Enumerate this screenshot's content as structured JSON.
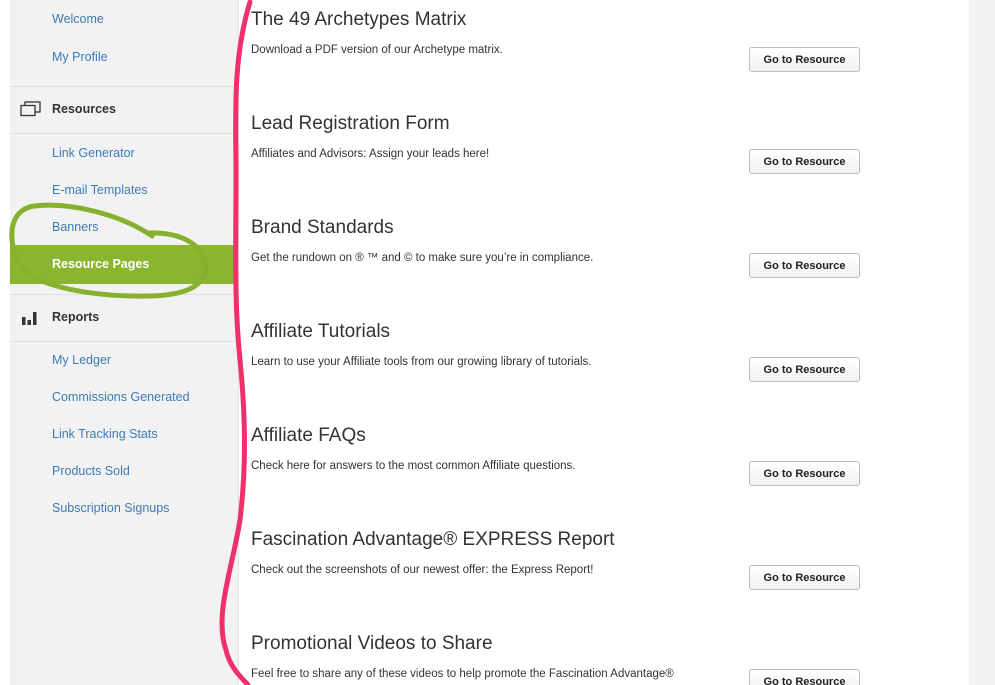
{
  "sidebar": {
    "top_links": [
      "Welcome",
      "My Profile"
    ],
    "resources": {
      "heading": "Resources",
      "icon": "monitor-icon",
      "items": [
        "Link Generator",
        "E-mail Templates",
        "Banners"
      ],
      "active_item": "Resource Pages"
    },
    "reports": {
      "heading": "Reports",
      "icon": "bar-chart-icon",
      "items": [
        "My Ledger",
        "Commissions Generated",
        "Link Tracking Stats",
        "Products Sold",
        "Subscription Signups"
      ]
    }
  },
  "resources": [
    {
      "title": "The 49 Archetypes Matrix",
      "description": "Download a PDF version of our Archetype matrix.",
      "button": "Go to Resource"
    },
    {
      "title": "Lead Registration Form",
      "description": "Affiliates and Advisors: Assign your leads here!",
      "button": "Go to Resource"
    },
    {
      "title": "Brand Standards",
      "description": "Get the rundown on ® ™ and © to make sure you’re in compliance.",
      "button": "Go to Resource"
    },
    {
      "title": "Affiliate Tutorials",
      "description": "Learn to use your Affiliate tools from our growing library of tutorials.",
      "button": "Go to Resource"
    },
    {
      "title": "Affiliate FAQs",
      "description": "Check here for answers to the most common Affiliate questions.",
      "button": "Go to Resource"
    },
    {
      "title": "Fascination Advantage® EXPRESS Report",
      "description": "Check out the screenshots of our newest offer: the Express Report!",
      "button": "Go to Resource"
    },
    {
      "title": "Promotional Videos to Share",
      "description": "Feel free to share any of these videos to help promote the Fascination Advantage®",
      "button": "Go to Resource"
    }
  ],
  "colors": {
    "active_green": "#8ab52f",
    "link_blue": "#3d7bb8",
    "annotation_pink": "#f0306a",
    "annotation_green": "#86b02e"
  }
}
